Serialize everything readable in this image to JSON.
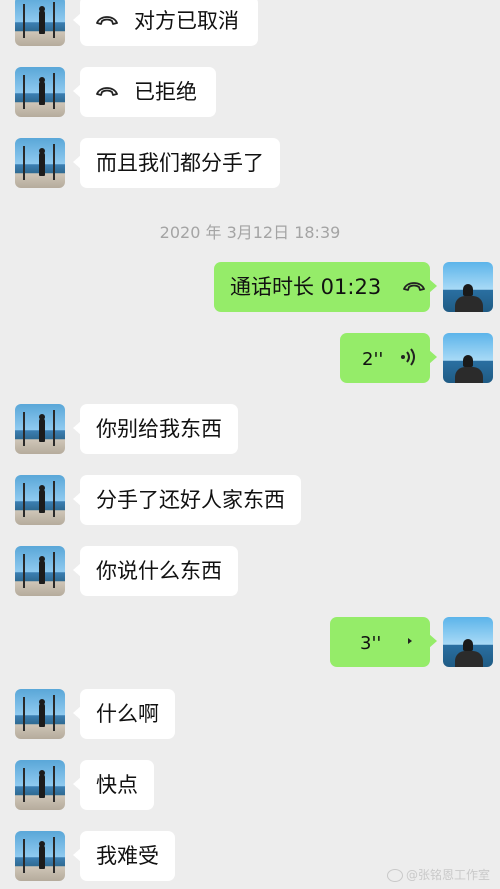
{
  "timestamp": "2020 年 3月12日 18:39",
  "messages": {
    "m1": "对方已取消",
    "m2": "已拒绝",
    "m3": "而且我们都分手了",
    "m4": "通话时长 01:23",
    "m5": "2''",
    "m6": "你别给我东西",
    "m7": "分手了还好人家东西",
    "m8": "你说什么东西",
    "m9": "3''",
    "m10": "什么啊",
    "m11": "快点",
    "m12": "我难受"
  },
  "watermark": "@张铭恩工作室",
  "colors": {
    "background": "#ededed",
    "sent_bubble": "#95ec69",
    "received_bubble": "#ffffff",
    "timestamp": "#a4a4a4"
  }
}
